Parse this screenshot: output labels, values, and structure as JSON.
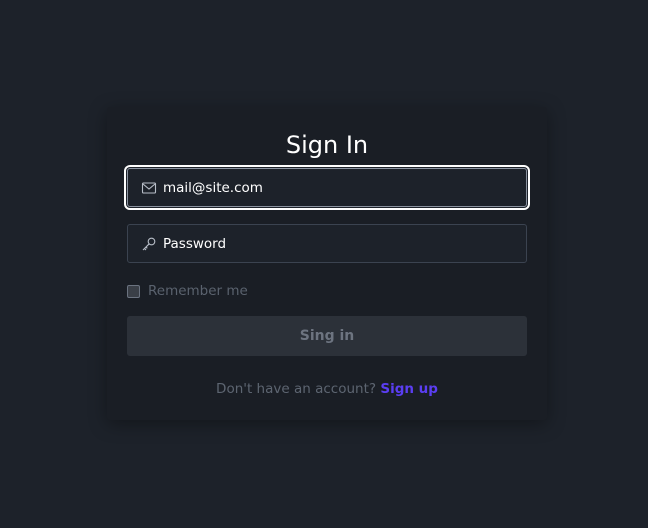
{
  "form": {
    "title": "Sign In",
    "email": {
      "value": "mail@site.com",
      "placeholder": "mail@site.com",
      "icon": "mail-icon"
    },
    "password": {
      "value": "",
      "placeholder": "Password",
      "icon": "key-icon"
    },
    "remember_label": "Remember me",
    "remember_checked": false,
    "submit_label": "Sing in",
    "signup_prompt": "Don't have an account?",
    "signup_link": "Sign up"
  },
  "colors": {
    "background": "#1d222a",
    "card": "#1a1e25",
    "accent_link": "#5b3ef2",
    "button_bg": "#2c3139",
    "muted_text": "#5d6571"
  }
}
